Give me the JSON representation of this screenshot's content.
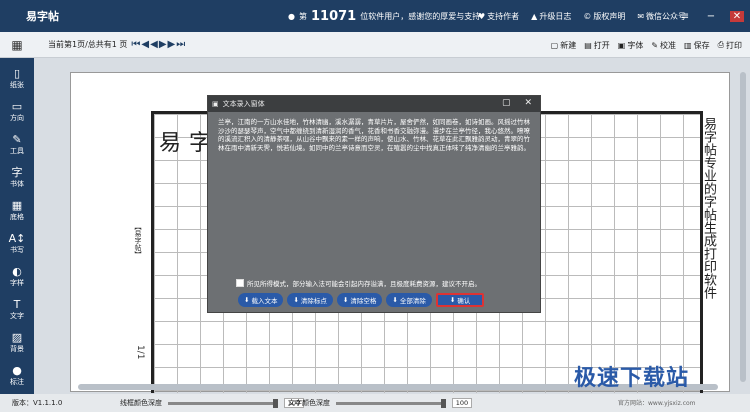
{
  "app": {
    "title": "易字帖"
  },
  "header": {
    "user_prefix": "第",
    "user_number": "11071",
    "user_suffix": "位软件用户，感谢您的厚爱与支持",
    "links": [
      {
        "icon": "heart-icon",
        "label": "支持作者"
      },
      {
        "icon": "upgrade-icon",
        "label": "升级日志"
      },
      {
        "icon": "copyright-icon",
        "label": "版权声明"
      },
      {
        "icon": "wechat-icon",
        "label": "微信公众号"
      }
    ]
  },
  "toolbar": {
    "page_info": "当前第1页/总共有1 页",
    "actions": [
      {
        "icon": "new-icon",
        "label": "新建"
      },
      {
        "icon": "open-icon",
        "label": "打开"
      },
      {
        "icon": "font-icon",
        "label": "字体"
      },
      {
        "icon": "proofread-icon",
        "label": "校准"
      },
      {
        "icon": "save-icon",
        "label": "保存"
      },
      {
        "icon": "print-icon",
        "label": "打印"
      }
    ]
  },
  "sidebar": {
    "items": [
      {
        "icon": "paper-icon",
        "label": "纸张"
      },
      {
        "icon": "direction-icon",
        "label": "方向"
      },
      {
        "icon": "tool-icon",
        "label": "工具"
      },
      {
        "icon": "font-style-icon",
        "label": "书体"
      },
      {
        "icon": "grid-icon",
        "label": "底格"
      },
      {
        "icon": "writing-icon",
        "label": "书写"
      },
      {
        "icon": "char-style-icon",
        "label": "字样"
      },
      {
        "icon": "text-icon",
        "label": "文字"
      },
      {
        "icon": "background-icon",
        "label": "背景"
      },
      {
        "icon": "marker-icon",
        "label": "标注"
      }
    ]
  },
  "paper": {
    "title": "易字帖",
    "side_label": "【易字帖】",
    "page_num": "1/1",
    "vertical_text": "易字帖专业的字帖生成打印软件"
  },
  "dialog": {
    "title": "文本录入窗体",
    "text": "兰亭，江南的一方山水佳地，竹林清幽，溪水潺潺，青草片片，屋舍俨然，如同画卷，如诗如画。风摇过竹林沙沙的瑟瑟琴声，空气中都缠绕到清新湿润的香气，花香和书香交融弥漫。漫步在兰亭竹径，我心悠然。嘹嘹的溪流汇积入的清静茶嘿，从山谷中飘来的素一样的声响，使山水、竹林、花草在此汇飘雅韵灵动，青翠的竹林在雨中清新天霁，悦若仙境。如同中的兰亭诗意而空灵，在喧嚣的尘中找真正体味了纯净清幽的兰亭雅韵。",
    "checkbox_label": "所见所得模式，部分输入法可能会引起内存溢满，且极度耗费资源，建议不开启。",
    "buttons": [
      {
        "label": "载入文本"
      },
      {
        "label": "清除标点"
      },
      {
        "label": "清除空格"
      },
      {
        "label": "全部清除"
      }
    ],
    "ok_label": "确认"
  },
  "status": {
    "version": "版本：V1.1.1.0",
    "line_label": "线框颜色深度",
    "line_value": "100",
    "text_label": "文字颜色深度",
    "text_value": "100"
  },
  "watermark": {
    "text": "极速下载站",
    "url": "官方网站：www.yjsxiz.com"
  }
}
